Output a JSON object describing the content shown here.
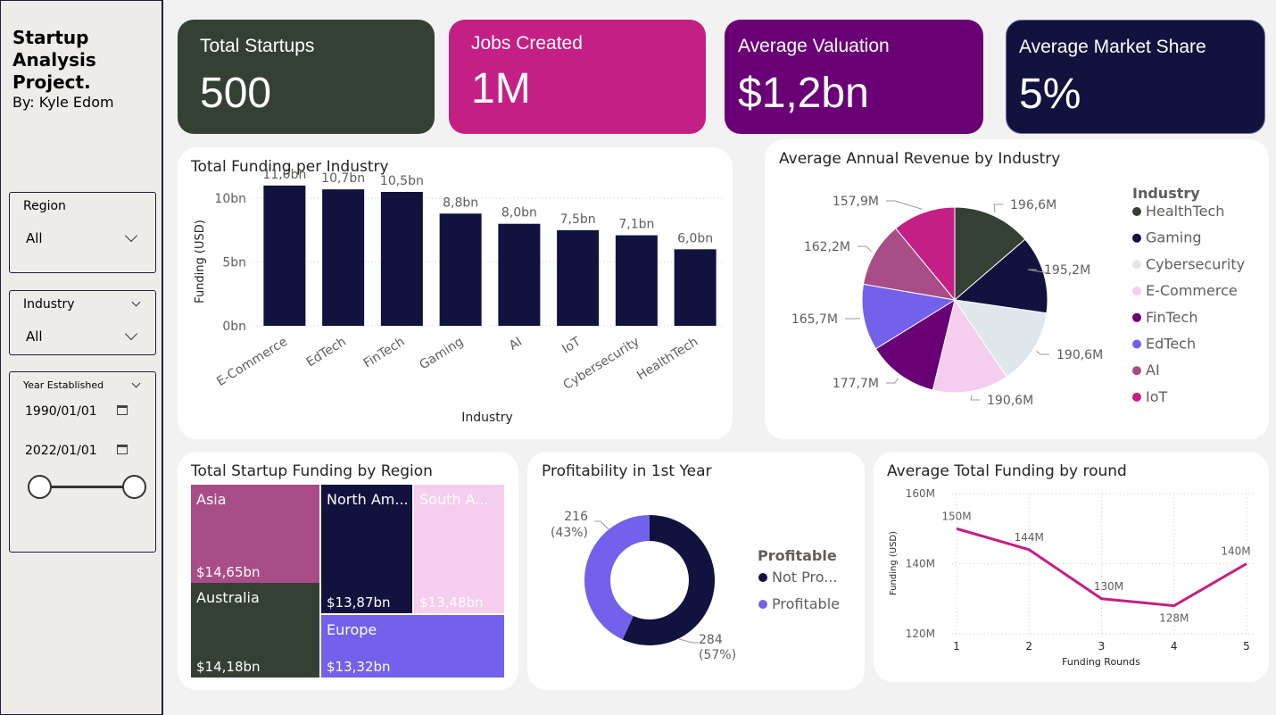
{
  "sidebar": {
    "title_lines": [
      "Startup",
      "Analysis",
      "Project."
    ],
    "author": "By: Kyle Edom",
    "region": {
      "label": "Region",
      "value": "All"
    },
    "industry": {
      "label": "Industry",
      "value": "All"
    },
    "year": {
      "label": "Year Established",
      "start": "1990/01/01",
      "end": "2022/01/01",
      "range_selected": [
        0,
        1
      ]
    }
  },
  "kpis": [
    {
      "title": "Total Startups",
      "value": "500",
      "color": "#354035"
    },
    {
      "title": "Jobs Created",
      "value": "1M",
      "color": "#c41f84"
    },
    {
      "title": "Average Valuation",
      "value": "$1,2bn",
      "color": "#6a0075"
    },
    {
      "title": "Average Market Share",
      "value": "5%",
      "color": "#12123f"
    }
  ],
  "charts": {
    "funding_industry": {
      "title": "Total Funding per Industry"
    },
    "revenue_industry": {
      "title": "Average Annual Revenue by Industry"
    },
    "funding_region": {
      "title": "Total Startup Funding by Region"
    },
    "profitability": {
      "title": "Profitability in 1st Year"
    },
    "funding_round": {
      "title": "Average Total Funding by round"
    }
  },
  "chart_data": [
    {
      "type": "bar",
      "title": "Total Funding per Industry",
      "xlabel": "Industry",
      "ylabel": "Funding (USD)",
      "categories": [
        "E-Commerce",
        "EdTech",
        "FinTech",
        "Gaming",
        "AI",
        "IoT",
        "Cybersecurity",
        "HealthTech"
      ],
      "values": [
        11.0,
        10.7,
        10.5,
        8.8,
        8.0,
        7.5,
        7.1,
        6.0
      ],
      "data_labels": [
        "11,0bn",
        "10,7bn",
        "10,5bn",
        "8,8bn",
        "8,0bn",
        "7,5bn",
        "7,1bn",
        "6,0bn"
      ],
      "yticks": [
        0,
        5,
        10
      ],
      "ytick_labels": [
        "0bn",
        "5bn",
        "10bn"
      ],
      "ylim": [
        0,
        12.6
      ],
      "color": "#12123f"
    },
    {
      "type": "pie",
      "title": "Average Annual Revenue by Industry",
      "legend_title": "Industry",
      "legend_position": "right",
      "labels": [
        "HealthTech",
        "Gaming",
        "Cybersecurity",
        "E-Commerce",
        "FinTech",
        "EdTech",
        "AI",
        "IoT"
      ],
      "values": [
        196.6,
        195.2,
        190.6,
        190.6,
        177.7,
        165.7,
        162.2,
        157.9
      ],
      "data_labels": [
        "196,6M",
        "195,2M",
        "190,6M",
        "190,6M",
        "177,7M",
        "165,7M",
        "162,2M",
        "157,9M"
      ],
      "colors": [
        "#354035",
        "#12123f",
        "#dfe6ec",
        "#f5cdee",
        "#6a0075",
        "#7360eb",
        "#a84d87",
        "#c41f84"
      ]
    },
    {
      "type": "treemap",
      "title": "Total Startup Funding by Region",
      "labels": [
        "Asia",
        "Australia",
        "North Am...",
        "South A...",
        "Europe"
      ],
      "values": [
        14.65,
        14.18,
        13.87,
        13.48,
        13.32
      ],
      "data_labels": [
        "$14,65bn",
        "$14,18bn",
        "$13,87bn",
        "$13,48bn",
        "$13,32bn"
      ],
      "colors": [
        "#a84d87",
        "#354035",
        "#12123f",
        "#f5cdee",
        "#7360eb"
      ]
    },
    {
      "type": "pie",
      "variant": "donut",
      "title": "Profitability in 1st Year",
      "legend_title": "Profitable",
      "legend_position": "right",
      "labels": [
        "Not Pro...",
        "Profitable"
      ],
      "values": [
        284,
        216
      ],
      "data_labels": [
        "284",
        "216"
      ],
      "percent_labels": [
        "(57%)",
        "(43%)"
      ],
      "colors": [
        "#12123f",
        "#7360eb"
      ]
    },
    {
      "type": "line",
      "title": "Average Total Funding by round",
      "xlabel": "Funding Rounds",
      "ylabel": "Funding (USD)",
      "x": [
        1,
        2,
        3,
        4,
        5
      ],
      "y": [
        150,
        144,
        130,
        128,
        140
      ],
      "data_labels": [
        "150M",
        "144M",
        "130M",
        "128M",
        "140M"
      ],
      "yticks": [
        120,
        140,
        160
      ],
      "ytick_labels": [
        "120M",
        "140M",
        "160M"
      ],
      "ylim": [
        120,
        160
      ],
      "grid": true,
      "color": "#c41f84"
    }
  ]
}
